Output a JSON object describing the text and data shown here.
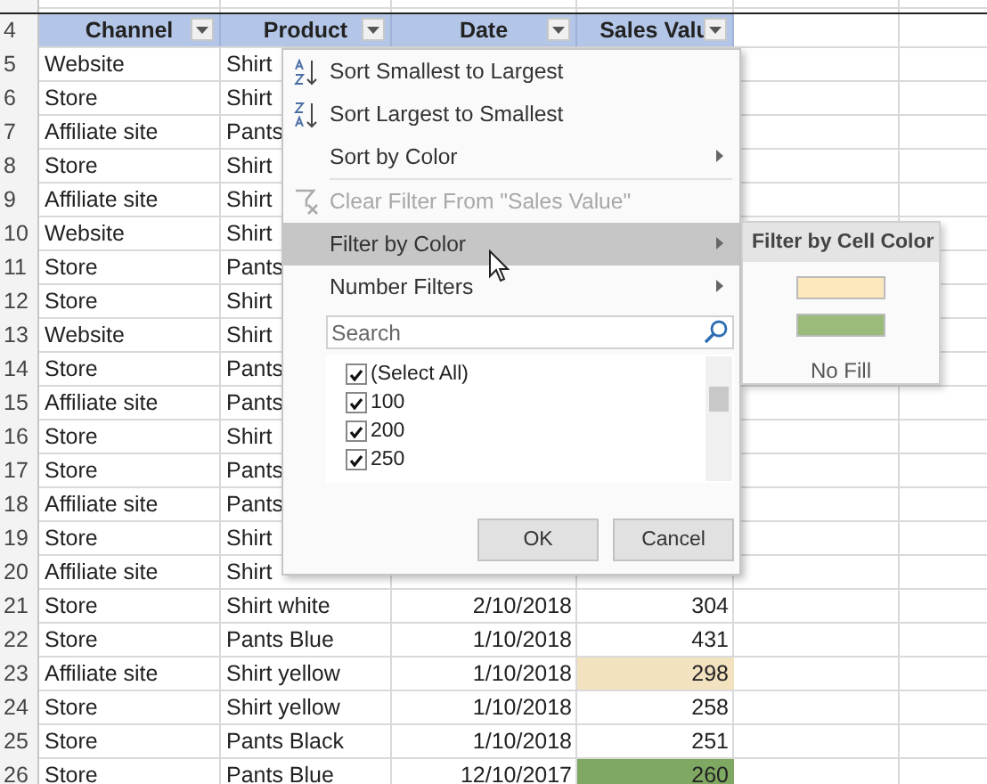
{
  "columns": [
    {
      "label": "Channel"
    },
    {
      "label": "Product"
    },
    {
      "label": "Date"
    },
    {
      "label": "Sales Valu"
    }
  ],
  "rows": [
    {
      "number": "4",
      "kind": "header"
    },
    {
      "number": "5",
      "channel": "Website",
      "product": "Shirt"
    },
    {
      "number": "6",
      "channel": "Store",
      "product": "Shirt"
    },
    {
      "number": "7",
      "channel": "Affiliate site",
      "product": "Pants"
    },
    {
      "number": "8",
      "channel": "Store",
      "product": "Shirt"
    },
    {
      "number": "9",
      "channel": "Affiliate site",
      "product": "Shirt"
    },
    {
      "number": "10",
      "channel": "Website",
      "product": "Shirt"
    },
    {
      "number": "11",
      "channel": "Store",
      "product": "Pants"
    },
    {
      "number": "12",
      "channel": "Store",
      "product": "Shirt"
    },
    {
      "number": "13",
      "channel": "Website",
      "product": "Shirt"
    },
    {
      "number": "14",
      "channel": "Store",
      "product": "Pants"
    },
    {
      "number": "15",
      "channel": "Affiliate site",
      "product": "Pants"
    },
    {
      "number": "16",
      "channel": "Store",
      "product": "Shirt"
    },
    {
      "number": "17",
      "channel": "Store",
      "product": "Pants"
    },
    {
      "number": "18",
      "channel": "Affiliate site",
      "product": "Pants"
    },
    {
      "number": "19",
      "channel": "Store",
      "product": "Shirt"
    },
    {
      "number": "20",
      "channel": "Affiliate site",
      "product": "Shirt"
    },
    {
      "number": "21",
      "channel": "Store",
      "product": "Shirt white",
      "date": "2/10/2018",
      "sales": "304"
    },
    {
      "number": "22",
      "channel": "Store",
      "product": "Pants Blue",
      "date": "1/10/2018",
      "sales": "431"
    },
    {
      "number": "23",
      "channel": "Affiliate site",
      "product": "Shirt yellow",
      "date": "1/10/2018",
      "sales": "298",
      "color": "#f2e2c0"
    },
    {
      "number": "24",
      "channel": "Store",
      "product": "Shirt yellow",
      "date": "1/10/2018",
      "sales": "258"
    },
    {
      "number": "25",
      "channel": "Store",
      "product": "Pants Black",
      "date": "1/10/2018",
      "sales": "251"
    },
    {
      "number": "26",
      "channel": "Store",
      "product": "Pants Blue",
      "date": "12/10/2017",
      "sales": "260",
      "color": "#7fa862"
    }
  ],
  "menu": {
    "items": [
      {
        "label": "Sort Smallest to Largest",
        "kind": "sort_ascending",
        "disabled": false,
        "selected": false
      },
      {
        "label": "Sort Largest to Smallest",
        "kind": "sort_descending",
        "disabled": false,
        "selected": false
      },
      {
        "label": "Sort by Color",
        "kind": "submenu",
        "disabled": false,
        "selected": false
      },
      {
        "label": "Clear Filter From \"Sales Value\"",
        "kind": "clear_filter",
        "disabled": true,
        "selected": false
      },
      {
        "label": "Filter by Color",
        "kind": "submenu",
        "disabled": false,
        "selected": true
      },
      {
        "label": "Number Filters",
        "kind": "submenu",
        "disabled": false,
        "selected": false
      }
    ],
    "search": {
      "placeholder": "Search"
    },
    "values": [
      {
        "label": "(Select All)",
        "checked": true
      },
      {
        "label": "100",
        "checked": true
      },
      {
        "label": "200",
        "checked": true
      },
      {
        "label": "250",
        "checked": true
      }
    ],
    "buttons": [
      "OK",
      "Cancel"
    ]
  },
  "submenu": {
    "title": "Filter by Cell Color",
    "swatches": [
      {
        "color": "#fde8bd"
      },
      {
        "color": "#9bbb7a"
      }
    ],
    "no_fill": "No Fill"
  }
}
